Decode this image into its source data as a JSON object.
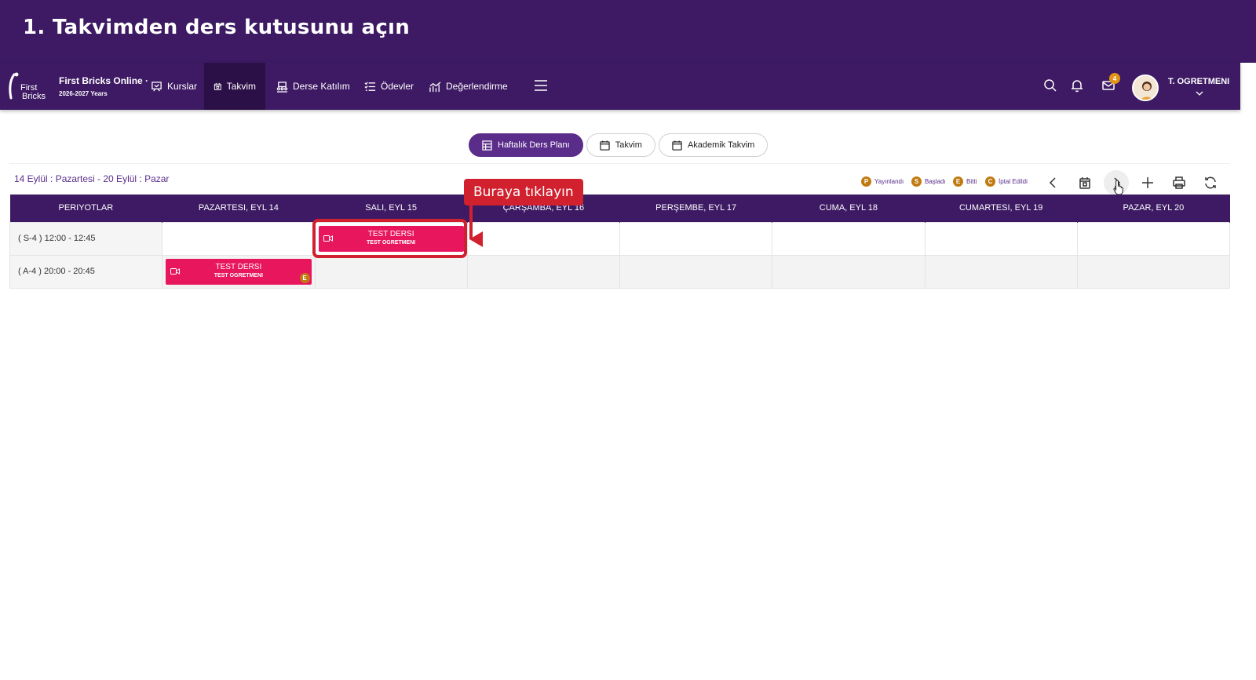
{
  "banner": {
    "title": "1. Takvimden ders kutusunu açın"
  },
  "brand": {
    "name": "First Bricks Online ·",
    "year": "2026-2027 Years",
    "logo_text": "First Bricks"
  },
  "nav": {
    "items": [
      {
        "label": "Kurslar",
        "icon": "courses-icon"
      },
      {
        "label": "Takvim",
        "icon": "calendar-icon",
        "active": true
      },
      {
        "label": "Derse Katılım",
        "icon": "attendance-icon"
      },
      {
        "label": "Ödevler",
        "icon": "list-check-icon"
      },
      {
        "label": "Değerlendirme",
        "icon": "chart-icon"
      }
    ],
    "user_name": "T. OGRETMENI",
    "mail_badge": "4"
  },
  "tabs": [
    {
      "label": "Haftalık Ders Planı",
      "active": true
    },
    {
      "label": "Takvim"
    },
    {
      "label": "Akademik Takvim"
    }
  ],
  "date_range": "14 Eylül : Pazartesi - 20 Eylül : Pazar",
  "legend": [
    {
      "key": "P",
      "label": "Yayınlandı"
    },
    {
      "key": "S",
      "label": "Başladı"
    },
    {
      "key": "E",
      "label": "Bitti"
    },
    {
      "key": "C",
      "label": "İptal Edildi"
    }
  ],
  "table": {
    "headers": [
      "PERIYOTLAR",
      "PAZARTESI, EYL 14",
      "SALI, EYL 15",
      "ÇARŞAMBA, EYL 16",
      "PERŞEMBE, EYL 17",
      "CUMA, EYL 18",
      "CUMARTESI, EYL 19",
      "PAZAR, EYL 20"
    ],
    "rows": [
      {
        "period": "( S-4 ) 12:00 - 12:45"
      },
      {
        "period": "( A-4 ) 20:00 - 20:45"
      }
    ],
    "lessons": [
      {
        "title": "TEST DERSI",
        "teacher": "TEST OGRETMENI"
      },
      {
        "title": "TEST DERSI",
        "teacher": "TEST OGRETMENI",
        "status": "E"
      }
    ]
  },
  "callout": {
    "text": "Buraya tıklayın"
  },
  "colors": {
    "primary": "#3d1a63",
    "lesson": "#e8175d",
    "callout": "#d1202e",
    "status": "#c07a10"
  }
}
